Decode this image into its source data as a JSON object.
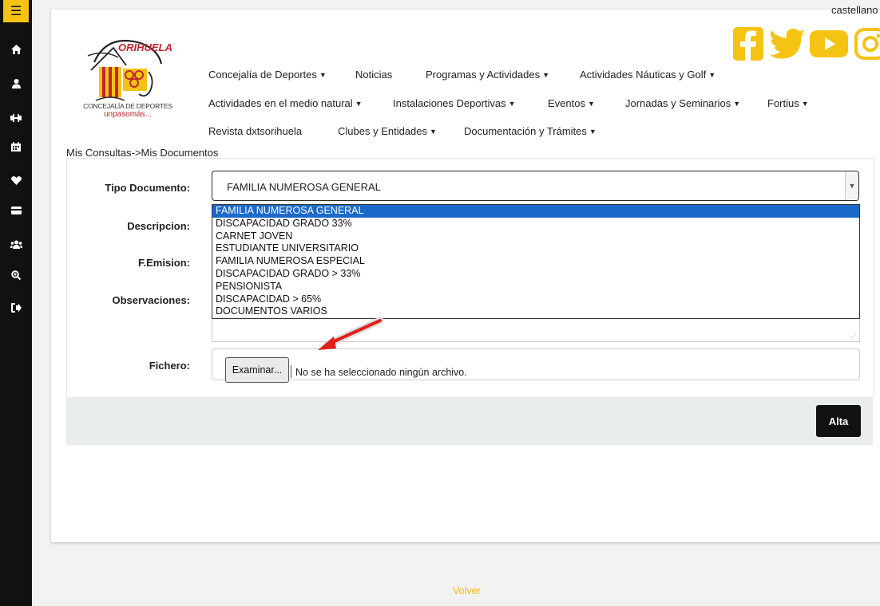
{
  "header": {
    "language": "castellano",
    "logo": {
      "brand": "ORIHUELA",
      "line1": "CONCEJALÍA DE DEPORTES",
      "line2": "unpasomás..."
    },
    "social": [
      "facebook-icon",
      "twitter-icon",
      "youtube-icon",
      "instagram-icon"
    ]
  },
  "colors": {
    "accent": "#f5c314",
    "selected": "#1b6ac9",
    "sidebar": "#111111",
    "link": "#f5b90e"
  },
  "sidebar": {
    "items": [
      "menu-icon",
      "home-icon",
      "user-icon",
      "dumbbell-icon",
      "calendar-icon",
      "heart-icon",
      "card-icon",
      "users-icon",
      "search-icon",
      "logout-icon"
    ]
  },
  "nav": {
    "concejalia": "Concejalía de Deportes",
    "noticias": "Noticias",
    "programas": "Programas y Actividades",
    "nauticas": "Actividades Náuticas y Golf",
    "medio_natural": "Actividades en el medio natural",
    "instalaciones": "Instalaciones Deportivas",
    "eventos": "Eventos",
    "jornadas": "Jornadas y Seminarios",
    "fortius": "Fortius",
    "revista": "Revista dxtsorihuela",
    "clubes": "Clubes y Entidades",
    "documentacion": "Documentación y Trámites"
  },
  "breadcrumb": "Mis Consultas->Mis Documentos",
  "form": {
    "labels": {
      "tipo": "Tipo Documento:",
      "descripcion": "Descripcion:",
      "femision": "F.Emision:",
      "observaciones": "Observaciones:",
      "fichero": "Fichero:"
    },
    "tipo_selected": "FAMILIA NUMEROSA GENERAL",
    "tipo_options": [
      "FAMILIA NUMEROSA GENERAL",
      "DISCAPACIDAD GRADO 33%",
      "CARNET JOVEN",
      "ESTUDIANTE UNIVERSITARIO",
      "FAMILIA NUMEROSA ESPECIAL",
      "DISCAPACIDAD GRADO > 33%",
      "PENSIONISTA",
      "DISCAPACIDAD > 65%",
      "DOCUMENTOS VARIOS"
    ],
    "file_button": "Examinar...",
    "file_status": "No se ha seleccionado ningún archivo.",
    "submit": "Alta"
  },
  "footer": {
    "back": "Volver"
  }
}
